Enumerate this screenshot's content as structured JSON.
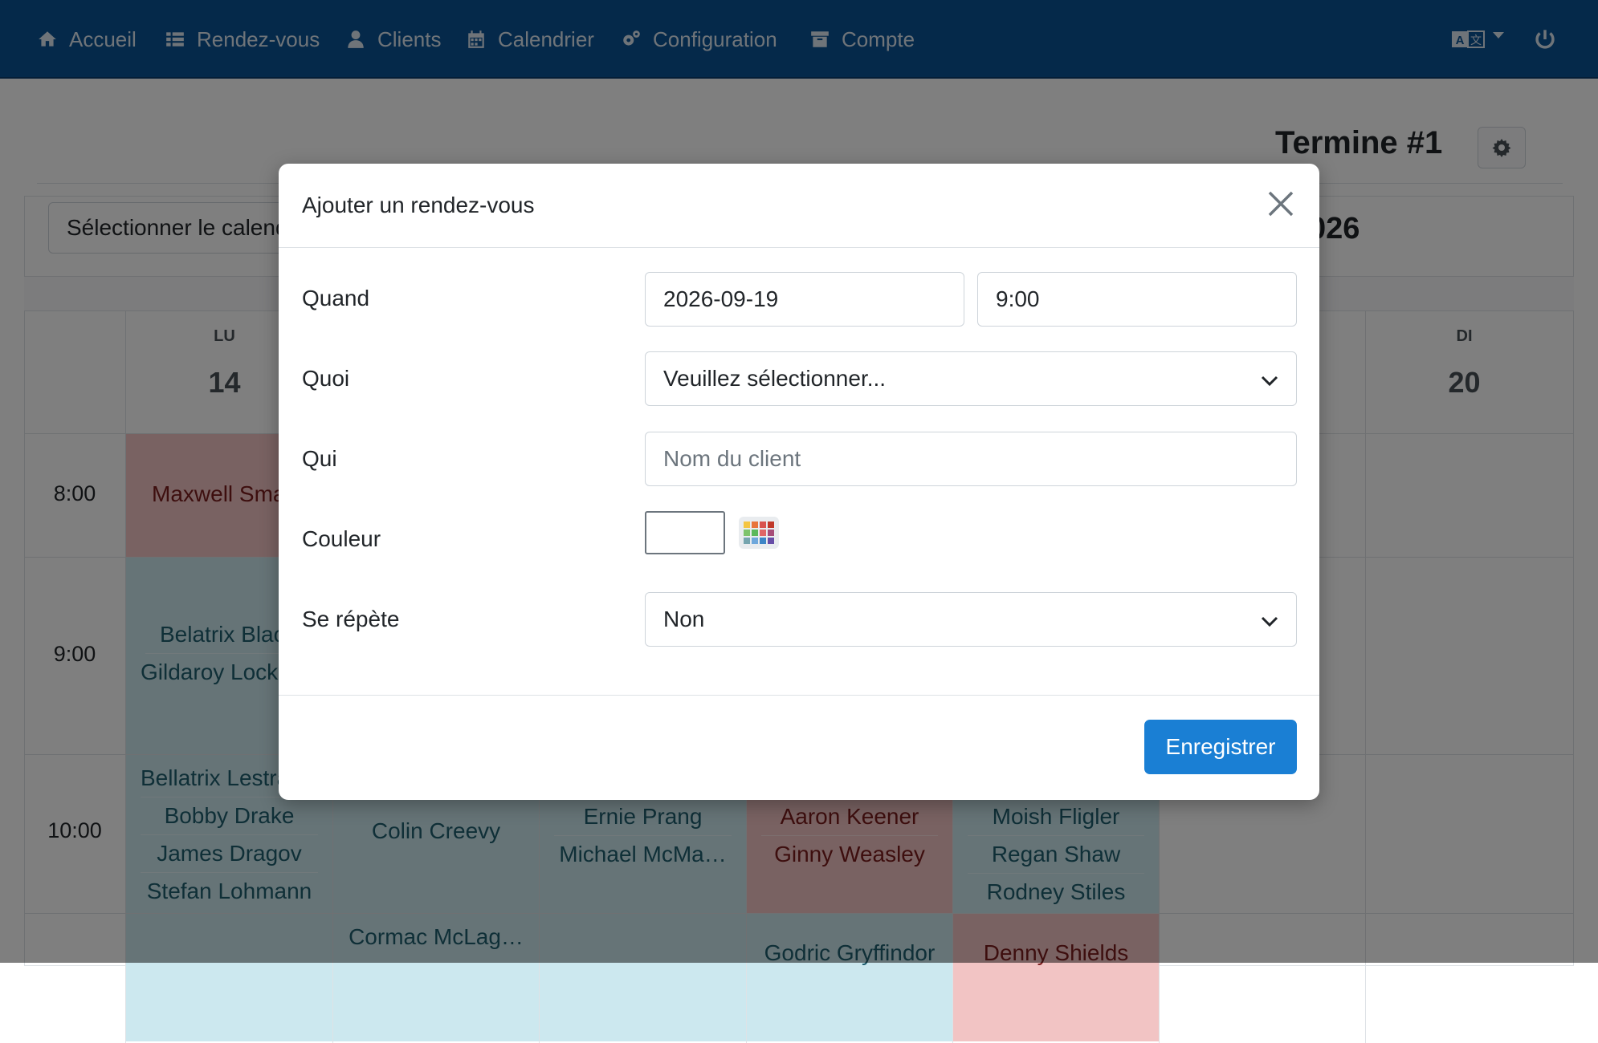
{
  "nav": {
    "items": [
      {
        "label": "Accueil",
        "icon": "home-icon"
      },
      {
        "label": "Rendez-vous",
        "icon": "list-icon"
      },
      {
        "label": "Clients",
        "icon": "user-icon"
      },
      {
        "label": "Calendrier",
        "icon": "calendar-icon"
      },
      {
        "label": "Configuration",
        "icon": "cogs-icon"
      },
      {
        "label": "Compte",
        "icon": "archive-icon"
      }
    ],
    "right_icons": [
      "language-icon",
      "power-icon"
    ],
    "bar_color": "#0b5394"
  },
  "page": {
    "title": "Termine #1",
    "calendar_select_label": "Sélectionner le calendrier",
    "year_label": "026"
  },
  "calendar": {
    "days": [
      {
        "abbr": "LU",
        "num": "14"
      },
      {
        "abbr": "DI",
        "num": "20"
      }
    ],
    "times": [
      "8:00",
      "9:00",
      "10:00"
    ],
    "events": {
      "mon_8": [
        "Maxwell Smart"
      ],
      "mon_9": [
        "Belatrix Black",
        "Gildaroy Lockhart"
      ],
      "mon_10": [
        "Bellatrix Lestrange",
        "Bobby Drake",
        "James Dragov",
        "Stefan Lohmann"
      ],
      "tue_10": [
        "Colin Creevy"
      ],
      "tue_11": [
        "Cormac McLag…"
      ],
      "wed_10": [
        "Ernie Prang",
        "Michael McMa…"
      ],
      "thu_10": [
        "Aaron Keener",
        "Ginny Weasley"
      ],
      "thu_11": [
        "Godric Gryffindor"
      ],
      "fri_10": [
        "Moish Fligler",
        "Regan Shaw",
        "Rodney Stiles"
      ],
      "fri_11": [
        "Denny Shields"
      ]
    }
  },
  "modal": {
    "title": "Ajouter un rendez-vous",
    "when_label": "Quand",
    "date_value": "2026-09-19",
    "time_value": "9:00",
    "what_label": "Quoi",
    "what_value": "Veuillez sélectionner...",
    "who_label": "Qui",
    "who_placeholder": "Nom du client",
    "color_label": "Couleur",
    "repeat_label": "Se répète",
    "repeat_value": "Non",
    "save_label": "Enregistrer",
    "save_color": "#1a7fd4"
  }
}
